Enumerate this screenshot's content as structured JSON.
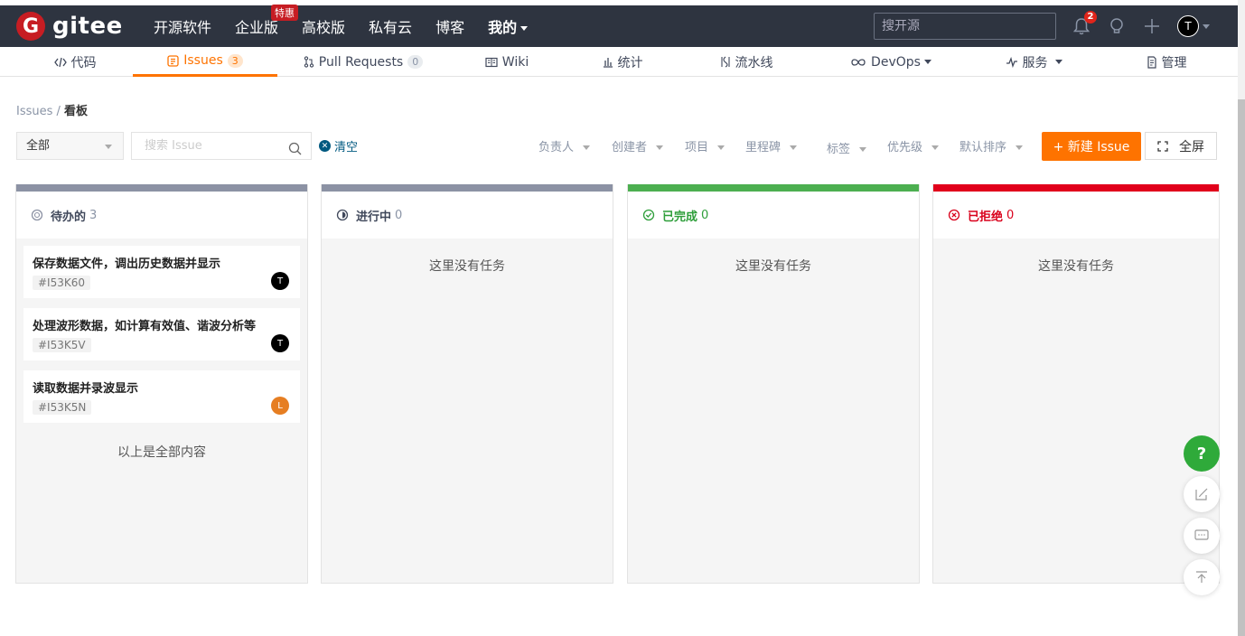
{
  "header": {
    "logo_letter": "G",
    "logo_text": "gitee",
    "nav": [
      {
        "label": "开源软件"
      },
      {
        "label": "企业版",
        "badge": "特惠"
      },
      {
        "label": "高校版"
      },
      {
        "label": "私有云"
      },
      {
        "label": "博客"
      },
      {
        "label": "我的"
      }
    ],
    "search_placeholder": "搜开源",
    "notify_count": "2",
    "avatar_letter": "T"
  },
  "subnav": {
    "code": "代码",
    "issues": "Issues",
    "issues_count": "3",
    "pull_requests": "Pull Requests",
    "pr_count": "0",
    "wiki": "Wiki",
    "stats": "统计",
    "pipeline": "流水线",
    "devops": "DevOps",
    "services": "服务",
    "manage": "管理"
  },
  "breadcrumb": {
    "root": "Issues",
    "sep": " / ",
    "current": "看板"
  },
  "filters": {
    "scope": "全部",
    "search_placeholder": "搜索 Issue",
    "clear": "清空",
    "assignee": "负责人",
    "creator": "创建者",
    "project": "项目",
    "milestone": "里程碑",
    "label": "标签",
    "priority": "优先级",
    "sort": "默认排序",
    "new_issue": "+ 新建 Issue",
    "fullscreen": "全屏"
  },
  "columns": [
    {
      "title": "待办的",
      "count": "3",
      "color": "#8c92a4",
      "title_color": "#40485b",
      "cards": [
        {
          "title": "保存数据文件，调出历史数据并显示",
          "id": "#I53K60",
          "avatar": "T",
          "avatar_color": "#000000"
        },
        {
          "title": "处理波形数据，如计算有效值、谐波分析等",
          "id": "#I53K5V",
          "avatar": "T",
          "avatar_color": "#000000"
        },
        {
          "title": "读取数据并录波显示",
          "id": "#I53K5N",
          "avatar": "L",
          "avatar_color": "#e67e22"
        }
      ],
      "footer": "以上是全部内容"
    },
    {
      "title": "进行中",
      "count": "0",
      "color": "#8c92a4",
      "title_color": "#40485b",
      "empty": "这里没有任务"
    },
    {
      "title": "已完成",
      "count": "0",
      "color": "#4caf50",
      "title_color": "#2e9e3a",
      "empty": "这里没有任务"
    },
    {
      "title": "已拒绝",
      "count": "0",
      "color": "#e1001b",
      "title_color": "#d9001b",
      "empty": "这里没有任务"
    }
  ],
  "float_help": "?"
}
